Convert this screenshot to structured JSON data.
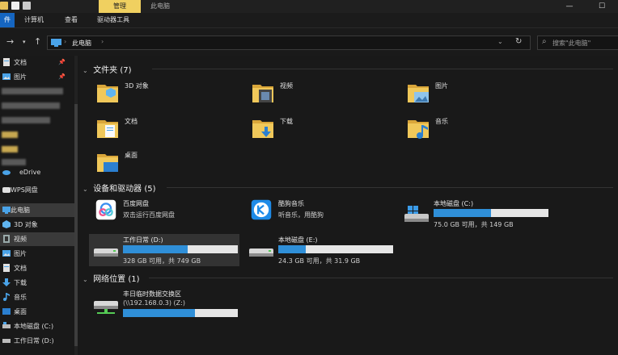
{
  "titlebar": {
    "manage_tab": "管理",
    "window_title": "此电脑",
    "minimize": "—",
    "maximize": "☐"
  },
  "ribbon": {
    "file_tab": "件",
    "tabs": [
      "计算机",
      "查看",
      "驱动器工具"
    ]
  },
  "address": {
    "back": "→",
    "up": "↑",
    "path": "此电脑",
    "separator": "›",
    "refresh": "↻",
    "search_placeholder": "搜索\"此电脑\"",
    "search_icon": "⌕"
  },
  "sidebar": {
    "items": [
      {
        "label": "文档",
        "icon": "document-icon",
        "pinned": true
      },
      {
        "label": "图片",
        "icon": "pictures-icon",
        "pinned": true
      },
      {
        "label": "eDrive",
        "icon": "onedrive-icon"
      },
      {
        "label": "WPS网盘",
        "icon": "wps-cloud-icon"
      },
      {
        "label": "此电脑",
        "icon": "this-pc-icon",
        "selected": true
      },
      {
        "label": "3D 对象",
        "icon": "3d-objects-icon"
      },
      {
        "label": "视频",
        "icon": "videos-icon",
        "selected": true
      },
      {
        "label": "图片",
        "icon": "pictures-icon"
      },
      {
        "label": "文档",
        "icon": "document-icon"
      },
      {
        "label": "下载",
        "icon": "download-icon"
      },
      {
        "label": "音乐",
        "icon": "music-icon"
      },
      {
        "label": "桌面",
        "icon": "desktop-icon"
      },
      {
        "label": "本地磁盘 (C:)",
        "icon": "drive-icon"
      },
      {
        "label": "工作日常 (D:)",
        "icon": "drive-icon"
      }
    ],
    "pin_glyph": "📌"
  },
  "sections": {
    "folders": {
      "title": "文件夹 (7)",
      "chevron": "⌄"
    },
    "devices": {
      "title": "设备和驱动器 (5)",
      "chevron": "⌄"
    },
    "network": {
      "title": "网络位置 (1)",
      "chevron": "⌄"
    }
  },
  "folders": [
    {
      "name": "3D 对象",
      "icon": "3d-objects-folder-icon"
    },
    {
      "name": "视频",
      "icon": "videos-folder-icon"
    },
    {
      "name": "图片",
      "icon": "pictures-folder-icon"
    },
    {
      "name": "文档",
      "icon": "documents-folder-icon"
    },
    {
      "name": "下载",
      "icon": "downloads-folder-icon"
    },
    {
      "name": "音乐",
      "icon": "music-folder-icon"
    },
    {
      "name": "桌面",
      "icon": "desktop-folder-icon"
    }
  ],
  "devices": [
    {
      "name": "百度网盘",
      "sub": "双击运行百度网盘",
      "icon": "baidu-netdisk-icon",
      "type": "app"
    },
    {
      "name": "酷狗音乐",
      "sub": "听音乐，用酷狗",
      "icon": "kugou-music-icon",
      "type": "app"
    },
    {
      "name": "本地磁盘 (C:)",
      "sub": "75.0 GB 可用，共 149 GB",
      "icon": "windows-drive-icon",
      "type": "drive",
      "used_fraction": 0.5
    },
    {
      "name": "工作日常 (D:)",
      "sub": "328 GB 可用，共 749 GB",
      "icon": "drive-icon",
      "type": "drive",
      "used_fraction": 0.56,
      "highlighted": true
    },
    {
      "name": "本地磁盘 (E:)",
      "sub": "24.3 GB 可用，共 31.9 GB",
      "icon": "drive-icon",
      "type": "drive",
      "used_fraction": 0.24
    }
  ],
  "network": [
    {
      "name": "丰日临时数据交换区",
      "sub": "(\\\\192.168.0.3) (Z:)",
      "icon": "network-drive-icon",
      "used_fraction": 0.63
    }
  ],
  "colors": {
    "background": "#191919",
    "accent": "#2f8fd8",
    "manage_tab": "#f0d060",
    "folder": "#e8c15a"
  }
}
